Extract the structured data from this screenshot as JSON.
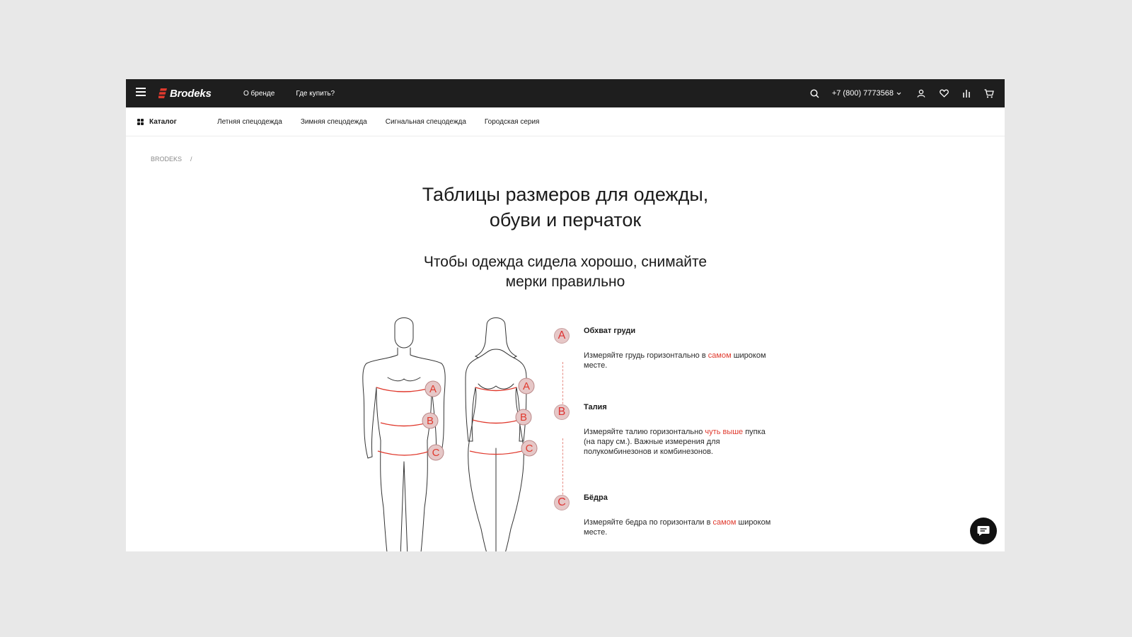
{
  "header": {
    "brand": "Brodeks",
    "nav": [
      "О бренде",
      "Где купить?"
    ],
    "phone": "+7 (800) 7773568"
  },
  "catalog": {
    "label": "Каталог",
    "links": [
      "Летняя спецодежда",
      "Зимняя спецодежда",
      "Сигнальная спецодежда",
      "Городская серия"
    ]
  },
  "breadcrumb": {
    "home": "BRODEKS",
    "separator": "/"
  },
  "page": {
    "title_line1": "Таблицы размеров для одежды,",
    "title_line2": "обуви и перчаток",
    "subtitle_line1": "Чтобы одежда сидела хорошо, снимайте",
    "subtitle_line2": "мерки правильно"
  },
  "measurements": [
    {
      "letter": "A",
      "title": "Обхват груди",
      "text_before": "Измеряйте грудь горизонтально в ",
      "highlight": "самом",
      "text_after": " широком месте."
    },
    {
      "letter": "B",
      "title": "Талия",
      "text_before": "Измеряйте талию горизонтально ",
      "highlight": "чуть выше",
      "text_after": " пупка (на пару см.). Важные измерения для полукомбинезонов и комбинезонов."
    },
    {
      "letter": "C",
      "title": "Бёдра",
      "text_before": "Измеряйте бедра по горизонтали в ",
      "highlight": "самом",
      "text_after": " широком месте."
    }
  ],
  "figure_labels": [
    "A",
    "B",
    "C"
  ],
  "colors": {
    "accent": "#e03a2e",
    "header_bg": "#1e1e1e",
    "badge_bg": "#e6c7c7"
  },
  "icons": [
    "menu-icon",
    "search-icon",
    "user-icon",
    "heart-icon",
    "compare-icon",
    "cart-icon",
    "chat-icon"
  ]
}
